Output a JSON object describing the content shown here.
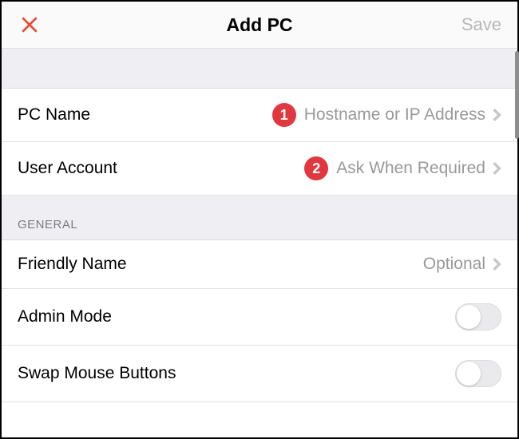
{
  "header": {
    "title": "Add PC",
    "save_label": "Save"
  },
  "rows": {
    "pc_name": {
      "label": "PC Name",
      "value": "Hostname or IP Address",
      "badge": "1"
    },
    "user_account": {
      "label": "User Account",
      "value": "Ask When Required",
      "badge": "2"
    },
    "friendly_name": {
      "label": "Friendly Name",
      "value": "Optional"
    },
    "admin_mode": {
      "label": "Admin Mode"
    },
    "swap_mouse": {
      "label": "Swap Mouse Buttons"
    }
  },
  "section_general": "GENERAL"
}
